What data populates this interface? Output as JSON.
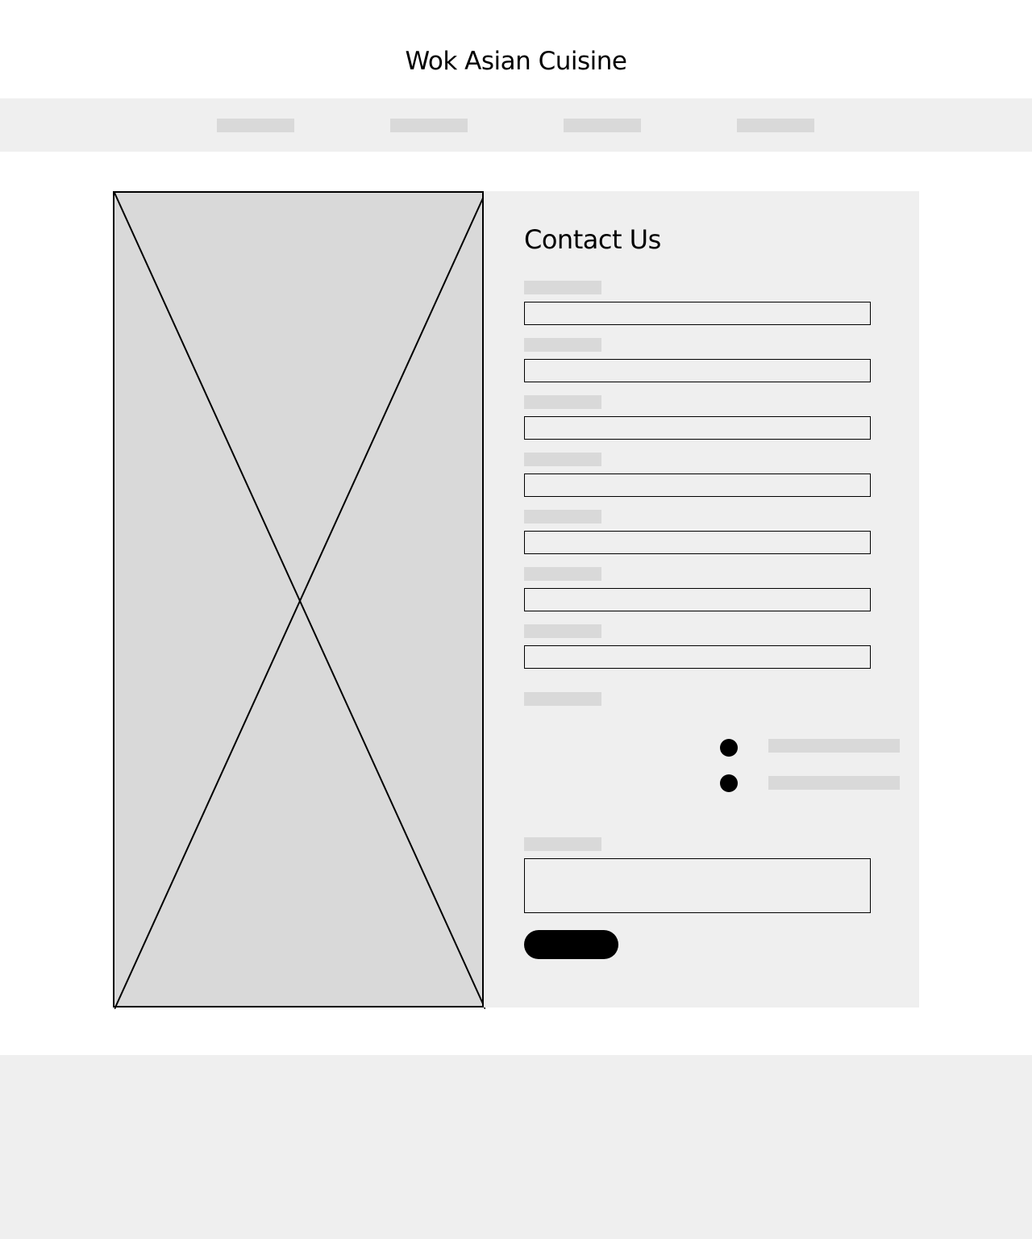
{
  "header": {
    "site_title": "Wok Asian Cuisine"
  },
  "nav": {
    "items": [
      "",
      "",
      "",
      ""
    ]
  },
  "contact": {
    "heading": "Contact Us",
    "fields": [
      {
        "label": "",
        "value": ""
      },
      {
        "label": "",
        "value": ""
      },
      {
        "label": "",
        "value": ""
      },
      {
        "label": "",
        "value": ""
      },
      {
        "label": "",
        "value": ""
      },
      {
        "label": "",
        "value": ""
      },
      {
        "label": "",
        "value": ""
      }
    ],
    "radio_group": {
      "label": "",
      "options": [
        "",
        ""
      ]
    },
    "message": {
      "label": "",
      "value": ""
    },
    "submit_label": ""
  },
  "colors": {
    "placeholder_gray": "#d9d9d9",
    "panel_gray": "#efefef",
    "ink": "#000000"
  },
  "icons": {
    "image_placeholder": "image-placeholder-icon"
  }
}
